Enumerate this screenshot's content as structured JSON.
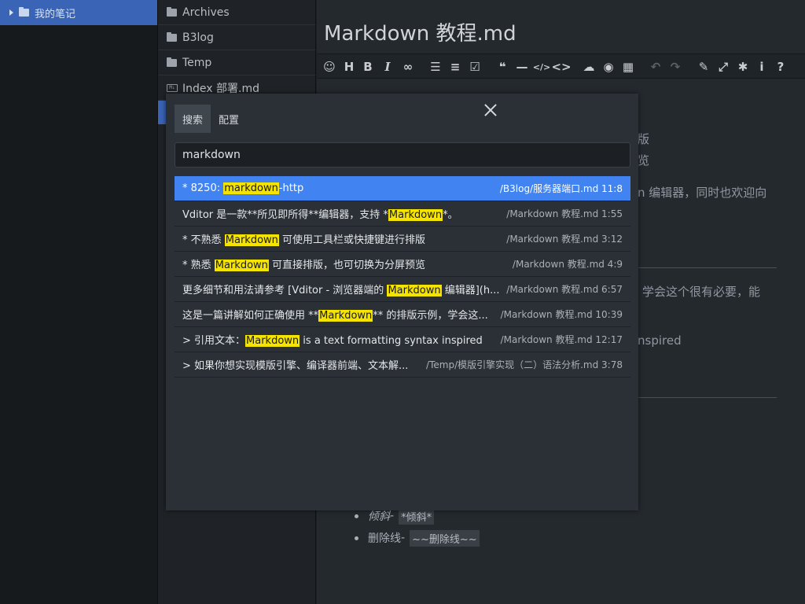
{
  "tree": {
    "root_label": "我的笔记"
  },
  "files": [
    {
      "label": "Archives",
      "type": "folder"
    },
    {
      "label": "B3log",
      "type": "folder"
    },
    {
      "label": "Temp",
      "type": "folder"
    },
    {
      "label": "Index 部署.md",
      "type": "md"
    }
  ],
  "editor": {
    "title": "Markdown 教程.md",
    "bg_lines": [
      "版",
      "览",
      "n 编辑器，同时也欢迎向",
      "学会这个很有必要，能",
      "nspired"
    ],
    "bullets": [
      {
        "label": "倾斜",
        "sep": " - ",
        "code": "*倾斜*"
      },
      {
        "label": "删除线",
        "sep": " - ",
        "code": "~~删除线~~"
      }
    ]
  },
  "toolbar_icons": [
    "emoji-icon",
    "heading-icon",
    "bold-icon",
    "italic-icon",
    "link-icon",
    "list-icon",
    "ordered-list-icon",
    "check-icon",
    "quote-icon",
    "line-icon",
    "inline-code-icon",
    "code-icon",
    "upload-icon",
    "record-icon",
    "table-icon",
    "undo-icon",
    "redo-icon",
    "edit-mode-icon",
    "fullscreen-icon",
    "debug-icon",
    "info-icon",
    "help-icon"
  ],
  "dialog": {
    "tabs": [
      "搜索",
      "配置"
    ],
    "query": "markdown",
    "results": [
      {
        "pre": "* 8250: ",
        "hl": "markdown",
        "post": "-http",
        "path": "/B3log/服务器端口.md 11:8"
      },
      {
        "pre": "Vditor 是一款**所见即所得**编辑器，支持 *",
        "hl": "Markdown",
        "post": "*。",
        "path": "/Markdown 教程.md 1:55"
      },
      {
        "pre": "* 不熟悉 ",
        "hl": "Markdown",
        "post": " 可使用工具栏或快捷键进行排版",
        "path": "/Markdown 教程.md 3:12"
      },
      {
        "pre": "* 熟悉 ",
        "hl": "Markdown",
        "post": " 可直接排版，也可切换为分屏预览",
        "path": "/Markdown 教程.md 4:9"
      },
      {
        "pre": "更多细节和用法请参考 [Vditor - 浏览器端的 ",
        "hl": "Markdown",
        "post": " 编辑器](h...",
        "path": "/Markdown 教程.md 6:57"
      },
      {
        "pre": "这是一篇讲解如何正确使用 **",
        "hl": "Markdown",
        "post": "** 的排版示例，学会这...",
        "path": "/Markdown 教程.md 10:39"
      },
      {
        "pre": "> 引用文本：",
        "hl": "Markdown",
        "post": " is a text formatting syntax inspired",
        "path": "/Markdown 教程.md 12:17"
      },
      {
        "pre": "> 如果你想实现模版引擎、编译器前端、文本解...",
        "hl": "",
        "post": "",
        "path": "/Temp/模版引擎实现（二）语法分析.md 3:78"
      }
    ]
  }
}
